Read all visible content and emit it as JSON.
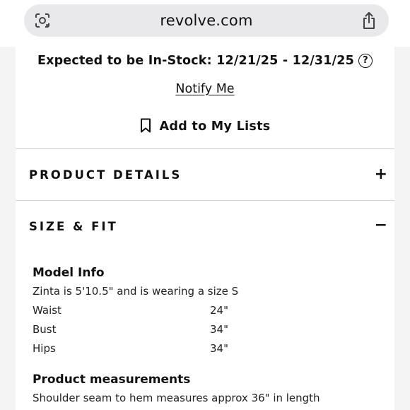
{
  "browser": {
    "url": "revolve.com",
    "lens_icon": "camera-lens-icon",
    "share_icon": "share-icon"
  },
  "stock": {
    "text": "Expected to be In-Stock: 12/21/25 - 12/31/25",
    "help": "?"
  },
  "notify": {
    "label": "Notify Me"
  },
  "lists": {
    "label": "Add to My Lists",
    "icon": "bookmark-icon"
  },
  "accordions": [
    {
      "title": "PRODUCT DETAILS",
      "sign": "+"
    },
    {
      "title": "SIZE & FIT",
      "sign": "−"
    }
  ],
  "model_info": {
    "heading": "Model Info",
    "description": "Zinta is 5'10.5\" and is wearing a size S",
    "rows": [
      {
        "label": "Waist",
        "value": "24\""
      },
      {
        "label": "Bust",
        "value": "34\""
      },
      {
        "label": "Hips",
        "value": "34\""
      }
    ]
  },
  "product_measurements": {
    "heading": "Product measurements",
    "text": "Shoulder seam to hem measures approx 36\" in length"
  }
}
